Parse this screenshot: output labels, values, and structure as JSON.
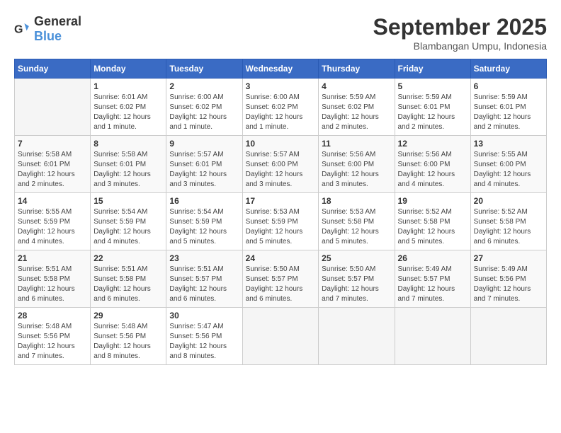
{
  "header": {
    "logo_general": "General",
    "logo_blue": "Blue",
    "month": "September 2025",
    "location": "Blambangan Umpu, Indonesia"
  },
  "calendar": {
    "days_of_week": [
      "Sunday",
      "Monday",
      "Tuesday",
      "Wednesday",
      "Thursday",
      "Friday",
      "Saturday"
    ],
    "weeks": [
      [
        {
          "day": "",
          "info": ""
        },
        {
          "day": "1",
          "info": "Sunrise: 6:01 AM\nSunset: 6:02 PM\nDaylight: 12 hours\nand 1 minute."
        },
        {
          "day": "2",
          "info": "Sunrise: 6:00 AM\nSunset: 6:02 PM\nDaylight: 12 hours\nand 1 minute."
        },
        {
          "day": "3",
          "info": "Sunrise: 6:00 AM\nSunset: 6:02 PM\nDaylight: 12 hours\nand 1 minute."
        },
        {
          "day": "4",
          "info": "Sunrise: 5:59 AM\nSunset: 6:02 PM\nDaylight: 12 hours\nand 2 minutes."
        },
        {
          "day": "5",
          "info": "Sunrise: 5:59 AM\nSunset: 6:01 PM\nDaylight: 12 hours\nand 2 minutes."
        },
        {
          "day": "6",
          "info": "Sunrise: 5:59 AM\nSunset: 6:01 PM\nDaylight: 12 hours\nand 2 minutes."
        }
      ],
      [
        {
          "day": "7",
          "info": "Sunrise: 5:58 AM\nSunset: 6:01 PM\nDaylight: 12 hours\nand 2 minutes."
        },
        {
          "day": "8",
          "info": "Sunrise: 5:58 AM\nSunset: 6:01 PM\nDaylight: 12 hours\nand 3 minutes."
        },
        {
          "day": "9",
          "info": "Sunrise: 5:57 AM\nSunset: 6:01 PM\nDaylight: 12 hours\nand 3 minutes."
        },
        {
          "day": "10",
          "info": "Sunrise: 5:57 AM\nSunset: 6:00 PM\nDaylight: 12 hours\nand 3 minutes."
        },
        {
          "day": "11",
          "info": "Sunrise: 5:56 AM\nSunset: 6:00 PM\nDaylight: 12 hours\nand 3 minutes."
        },
        {
          "day": "12",
          "info": "Sunrise: 5:56 AM\nSunset: 6:00 PM\nDaylight: 12 hours\nand 4 minutes."
        },
        {
          "day": "13",
          "info": "Sunrise: 5:55 AM\nSunset: 6:00 PM\nDaylight: 12 hours\nand 4 minutes."
        }
      ],
      [
        {
          "day": "14",
          "info": "Sunrise: 5:55 AM\nSunset: 5:59 PM\nDaylight: 12 hours\nand 4 minutes."
        },
        {
          "day": "15",
          "info": "Sunrise: 5:54 AM\nSunset: 5:59 PM\nDaylight: 12 hours\nand 4 minutes."
        },
        {
          "day": "16",
          "info": "Sunrise: 5:54 AM\nSunset: 5:59 PM\nDaylight: 12 hours\nand 5 minutes."
        },
        {
          "day": "17",
          "info": "Sunrise: 5:53 AM\nSunset: 5:59 PM\nDaylight: 12 hours\nand 5 minutes."
        },
        {
          "day": "18",
          "info": "Sunrise: 5:53 AM\nSunset: 5:58 PM\nDaylight: 12 hours\nand 5 minutes."
        },
        {
          "day": "19",
          "info": "Sunrise: 5:52 AM\nSunset: 5:58 PM\nDaylight: 12 hours\nand 5 minutes."
        },
        {
          "day": "20",
          "info": "Sunrise: 5:52 AM\nSunset: 5:58 PM\nDaylight: 12 hours\nand 6 minutes."
        }
      ],
      [
        {
          "day": "21",
          "info": "Sunrise: 5:51 AM\nSunset: 5:58 PM\nDaylight: 12 hours\nand 6 minutes."
        },
        {
          "day": "22",
          "info": "Sunrise: 5:51 AM\nSunset: 5:58 PM\nDaylight: 12 hours\nand 6 minutes."
        },
        {
          "day": "23",
          "info": "Sunrise: 5:51 AM\nSunset: 5:57 PM\nDaylight: 12 hours\nand 6 minutes."
        },
        {
          "day": "24",
          "info": "Sunrise: 5:50 AM\nSunset: 5:57 PM\nDaylight: 12 hours\nand 6 minutes."
        },
        {
          "day": "25",
          "info": "Sunrise: 5:50 AM\nSunset: 5:57 PM\nDaylight: 12 hours\nand 7 minutes."
        },
        {
          "day": "26",
          "info": "Sunrise: 5:49 AM\nSunset: 5:57 PM\nDaylight: 12 hours\nand 7 minutes."
        },
        {
          "day": "27",
          "info": "Sunrise: 5:49 AM\nSunset: 5:56 PM\nDaylight: 12 hours\nand 7 minutes."
        }
      ],
      [
        {
          "day": "28",
          "info": "Sunrise: 5:48 AM\nSunset: 5:56 PM\nDaylight: 12 hours\nand 7 minutes."
        },
        {
          "day": "29",
          "info": "Sunrise: 5:48 AM\nSunset: 5:56 PM\nDaylight: 12 hours\nand 8 minutes."
        },
        {
          "day": "30",
          "info": "Sunrise: 5:47 AM\nSunset: 5:56 PM\nDaylight: 12 hours\nand 8 minutes."
        },
        {
          "day": "",
          "info": ""
        },
        {
          "day": "",
          "info": ""
        },
        {
          "day": "",
          "info": ""
        },
        {
          "day": "",
          "info": ""
        }
      ]
    ]
  }
}
